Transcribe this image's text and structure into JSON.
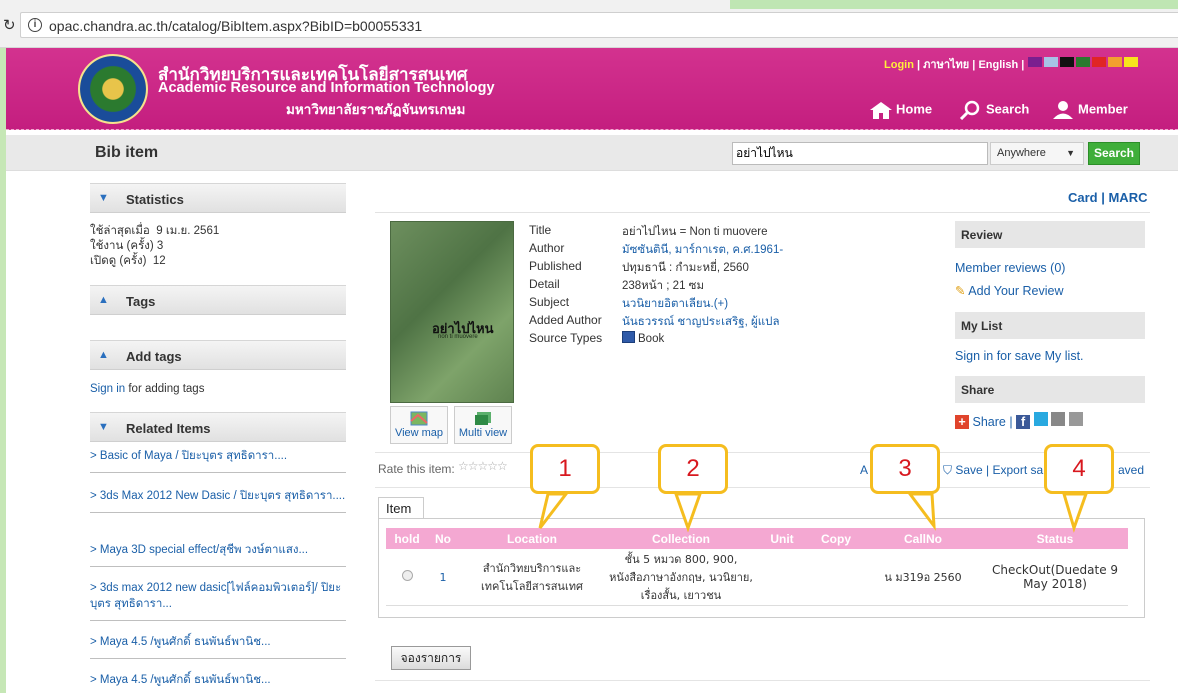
{
  "browser": {
    "url": "opac.chandra.ac.th/catalog/BibItem.aspx?BibID=b00055331"
  },
  "header": {
    "org_th": "สำนักวิทยบริการและเทคโนโลยีสารสนเทศ",
    "org_en": "Academic Resource and Information Technology",
    "university": "มหาวิทยาลัยราชภัฏจันทรเกษม",
    "top_links": {
      "login": "Login",
      "thai": "ภาษาไทย",
      "english": "English"
    },
    "swatches": [
      "#7b1f8f",
      "#a7c3e6",
      "#111111",
      "#2b7a2f",
      "#e02525",
      "#f2a02f",
      "#f7e51c"
    ],
    "nav": {
      "home": "Home",
      "search": "Search",
      "member": "Member"
    }
  },
  "title_bar": {
    "title": "Bib item",
    "search_value": "อย่าไปไหน",
    "scope": "Anywhere",
    "search_button": "Search"
  },
  "sidebar": {
    "statistics": {
      "title": "Statistics",
      "rows": [
        {
          "label": "ใช้ล่าสุดเมื่อ",
          "value": "9 เม.ย. 2561"
        },
        {
          "label": "ใช้งาน (ครั้ง)",
          "value": "3"
        },
        {
          "label": "เปิดดู (ครั้ง)",
          "value": "12"
        }
      ]
    },
    "tags_title": "Tags",
    "add_tags_title": "Add tags",
    "sign_in": "Sign in",
    "sign_in_rest": " for adding tags",
    "related_title": "Related Items",
    "related": [
      "> Basic of Maya / ปิยะบุตร สุทธิดารา....",
      "> 3ds Max 2012 New Dasic / ปิยะบุตร สุทธิดารา....",
      "> Maya 3D special effect/สุชีพ วงษ์ตาแสง...",
      "> 3ds max 2012 new dasic[ไฟล์คอมพิวเตอร์]/ ปิยะบุตร สุทธิดารา...",
      "> Maya 4.5 /พูนศักดิ์ ธนพันธ์พานิช...",
      "> Maya 4.5 /พูนศักดิ์ ธนพันธ์พานิช..."
    ]
  },
  "main": {
    "card_marc": "Card | MARC",
    "cover_title": "อย่าไปไหน",
    "cover_sub": "non ti muovere",
    "meta": [
      {
        "label": "Title",
        "value": "อย่าไปไหน = Non ti muovere"
      },
      {
        "label": "Author",
        "value": "มัซซันตินี, มาร์กาเรต, ค.ศ.1961-"
      },
      {
        "label": "Published",
        "value": "ปทุมธานี : กำมะหยี่, 2560"
      },
      {
        "label": "Detail",
        "value": "238หน้า ; 21 ซม"
      },
      {
        "label": "Subject",
        "value": "นวนิยายอิตาเลียน.(+)"
      },
      {
        "label": "Added Author",
        "value": "นันธวรรณ์ ชาญประเสริฐ, ผู้แปล"
      },
      {
        "label": "Source Types",
        "value": "Book"
      }
    ],
    "view_map": "View map",
    "multi_view": "Multi view",
    "rate_label": "Rate this item:",
    "stars": "☆☆☆☆☆",
    "actions": "Save | Export sa",
    "actions_right": "aved",
    "actions_left": "A",
    "review": {
      "review_head": "Review",
      "member_reviews": "Member reviews (0)",
      "add_review": "Add Your Review",
      "mylist_head": "My List",
      "mylist_link": "Sign in for save My list.",
      "share_head": "Share",
      "share_link": "Share"
    },
    "item_tab": "Item",
    "table": {
      "headers": [
        "hold",
        "No",
        "Location",
        "Collection",
        "Unit",
        "Copy",
        "CallNo",
        "Status"
      ],
      "row": {
        "no": "1",
        "location": "สำนักวิทยบริการและเทคโนโลยีสารสนเทศ",
        "collection": "ชั้น 5 หมวด 800, 900, หนังสือภาษาอังกฤษ, นวนิยาย, เรื่องสั้น, เยาวชน",
        "unit": "",
        "copy": "",
        "callno": "น ม319อ 2560",
        "status": "CheckOut(Duedate 9 May 2018)"
      }
    },
    "reserve_button": "จองรายการ"
  },
  "callouts": [
    "1",
    "2",
    "3",
    "4"
  ]
}
